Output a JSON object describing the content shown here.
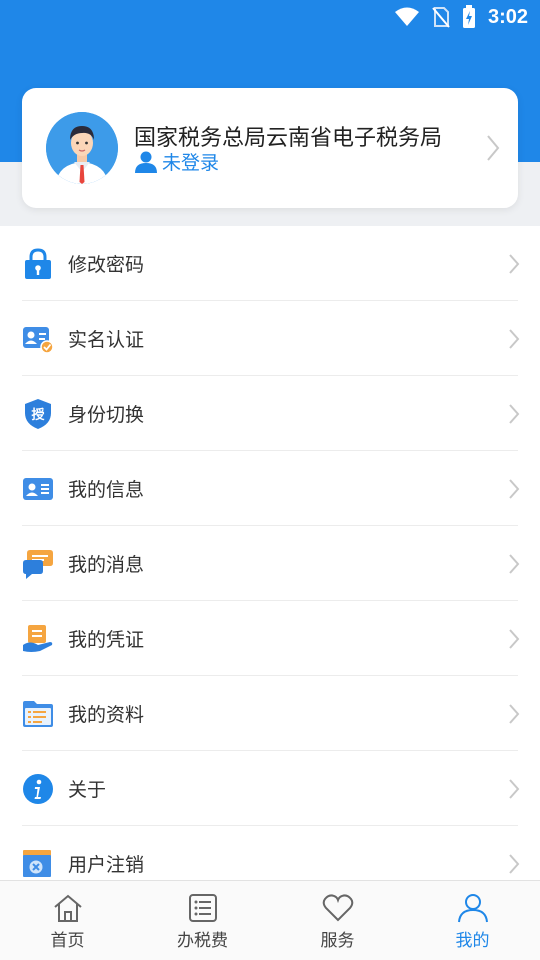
{
  "status_bar": {
    "time": "3:02"
  },
  "profile": {
    "org_name": "国家税务总局云南省电子税务局",
    "login_status": "未登录"
  },
  "menu": {
    "items": [
      {
        "label": "修改密码",
        "icon": "lock-icon"
      },
      {
        "label": "实名认证",
        "icon": "id-verify-icon"
      },
      {
        "label": "身份切换",
        "icon": "authorize-shield-icon"
      },
      {
        "label": "我的信息",
        "icon": "user-card-icon"
      },
      {
        "label": "我的消息",
        "icon": "chat-bubbles-icon"
      },
      {
        "label": "我的凭证",
        "icon": "voucher-icon"
      },
      {
        "label": "我的资料",
        "icon": "folder-icon"
      },
      {
        "label": "关于",
        "icon": "info-icon"
      },
      {
        "label": "用户注销",
        "icon": "cancel-account-icon"
      }
    ],
    "auth_badge_text": "授"
  },
  "tabbar": {
    "tabs": [
      {
        "label": "首页",
        "icon": "home-icon",
        "active": false
      },
      {
        "label": "办税费",
        "icon": "list-icon",
        "active": false
      },
      {
        "label": "服务",
        "icon": "heart-icon",
        "active": false
      },
      {
        "label": "我的",
        "icon": "person-icon",
        "active": true
      }
    ]
  },
  "colors": {
    "primary": "#1f87e8",
    "text": "#333333",
    "orange": "#f5a540"
  }
}
